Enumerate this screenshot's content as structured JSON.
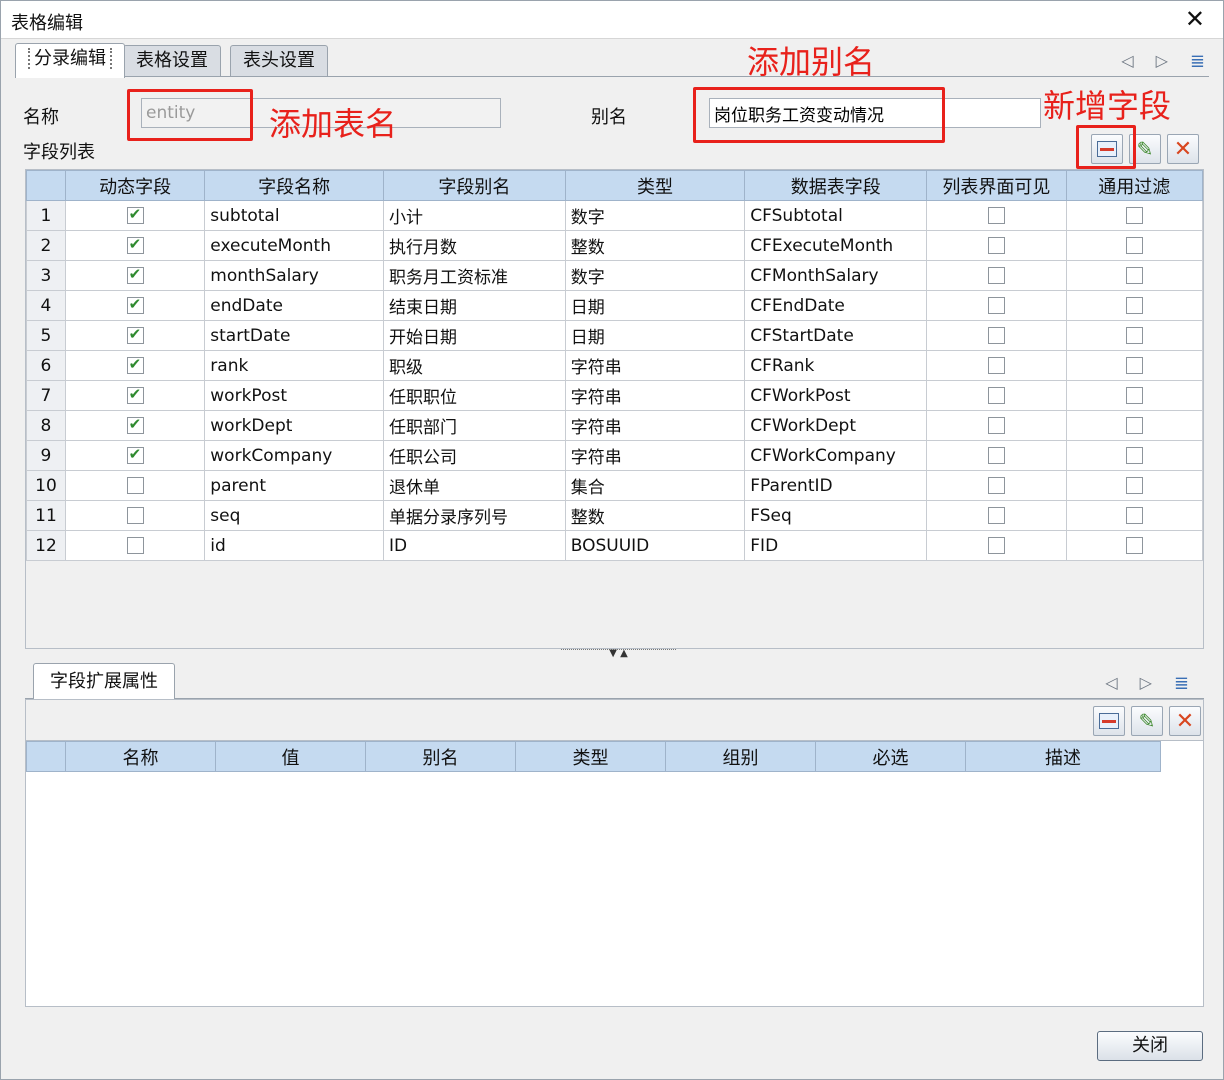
{
  "window": {
    "title": "表格编辑",
    "close_glyph": "✕"
  },
  "tabs": [
    "分录编辑",
    "表格设置",
    "表头设置"
  ],
  "nav": {
    "left": "◁",
    "right": "▷",
    "menu": "≣"
  },
  "form": {
    "name_label": "名称",
    "name_value": "entity",
    "alias_label": "别名",
    "alias_value": "岗位职务工资变动情况",
    "field_list_label": "字段列表"
  },
  "annotations": {
    "table_name": "添加表名",
    "alias": "添加别名",
    "new_field": "新增字段",
    "color": "#e8211b"
  },
  "toolbar_icons": [
    "add-row-icon",
    "edit-pen-icon",
    "delete-x-icon"
  ],
  "fields_table": {
    "columns": [
      "动态字段",
      "字段名称",
      "字段别名",
      "类型",
      "数据表字段",
      "列表界面可见",
      "通用过滤"
    ],
    "rows": [
      {
        "n": "1",
        "dynamic": true,
        "name": "subtotal",
        "alias": "小计",
        "type": "数字",
        "db": "CFSubtotal",
        "visible": false,
        "filter": false
      },
      {
        "n": "2",
        "dynamic": true,
        "name": "executeMonth",
        "alias": "执行月数",
        "type": "整数",
        "db": "CFExecuteMonth",
        "visible": false,
        "filter": false
      },
      {
        "n": "3",
        "dynamic": true,
        "name": "monthSalary",
        "alias": "职务月工资标准",
        "type": "数字",
        "db": "CFMonthSalary",
        "visible": false,
        "filter": false
      },
      {
        "n": "4",
        "dynamic": true,
        "name": "endDate",
        "alias": "结束日期",
        "type": "日期",
        "db": "CFEndDate",
        "visible": false,
        "filter": false
      },
      {
        "n": "5",
        "dynamic": true,
        "name": "startDate",
        "alias": "开始日期",
        "type": "日期",
        "db": "CFStartDate",
        "visible": false,
        "filter": false
      },
      {
        "n": "6",
        "dynamic": true,
        "name": "rank",
        "alias": "职级",
        "type": "字符串",
        "db": "CFRank",
        "visible": false,
        "filter": false
      },
      {
        "n": "7",
        "dynamic": true,
        "name": "workPost",
        "alias": "任职职位",
        "type": "字符串",
        "db": "CFWorkPost",
        "visible": false,
        "filter": false
      },
      {
        "n": "8",
        "dynamic": true,
        "name": "workDept",
        "alias": "任职部门",
        "type": "字符串",
        "db": "CFWorkDept",
        "visible": false,
        "filter": false
      },
      {
        "n": "9",
        "dynamic": true,
        "name": "workCompany",
        "alias": "任职公司",
        "type": "字符串",
        "db": "CFWorkCompany",
        "visible": false,
        "filter": false
      },
      {
        "n": "10",
        "dynamic": false,
        "name": "parent",
        "alias": "退休单",
        "type": "集合",
        "db": "FParentID",
        "visible": false,
        "filter": false
      },
      {
        "n": "11",
        "dynamic": false,
        "name": "seq",
        "alias": "单据分录序列号",
        "type": "整数",
        "db": "FSeq",
        "visible": false,
        "filter": false
      },
      {
        "n": "12",
        "dynamic": false,
        "name": "id",
        "alias": "ID",
        "type": "BOSUUID",
        "db": "FID",
        "visible": false,
        "filter": false
      }
    ]
  },
  "splitter_glyph": "▼ ▲",
  "ext": {
    "tab_label": "字段扩展属性",
    "columns": [
      "名称",
      "值",
      "别名",
      "类型",
      "组别",
      "必选",
      "描述"
    ]
  },
  "close_button": "关闭"
}
